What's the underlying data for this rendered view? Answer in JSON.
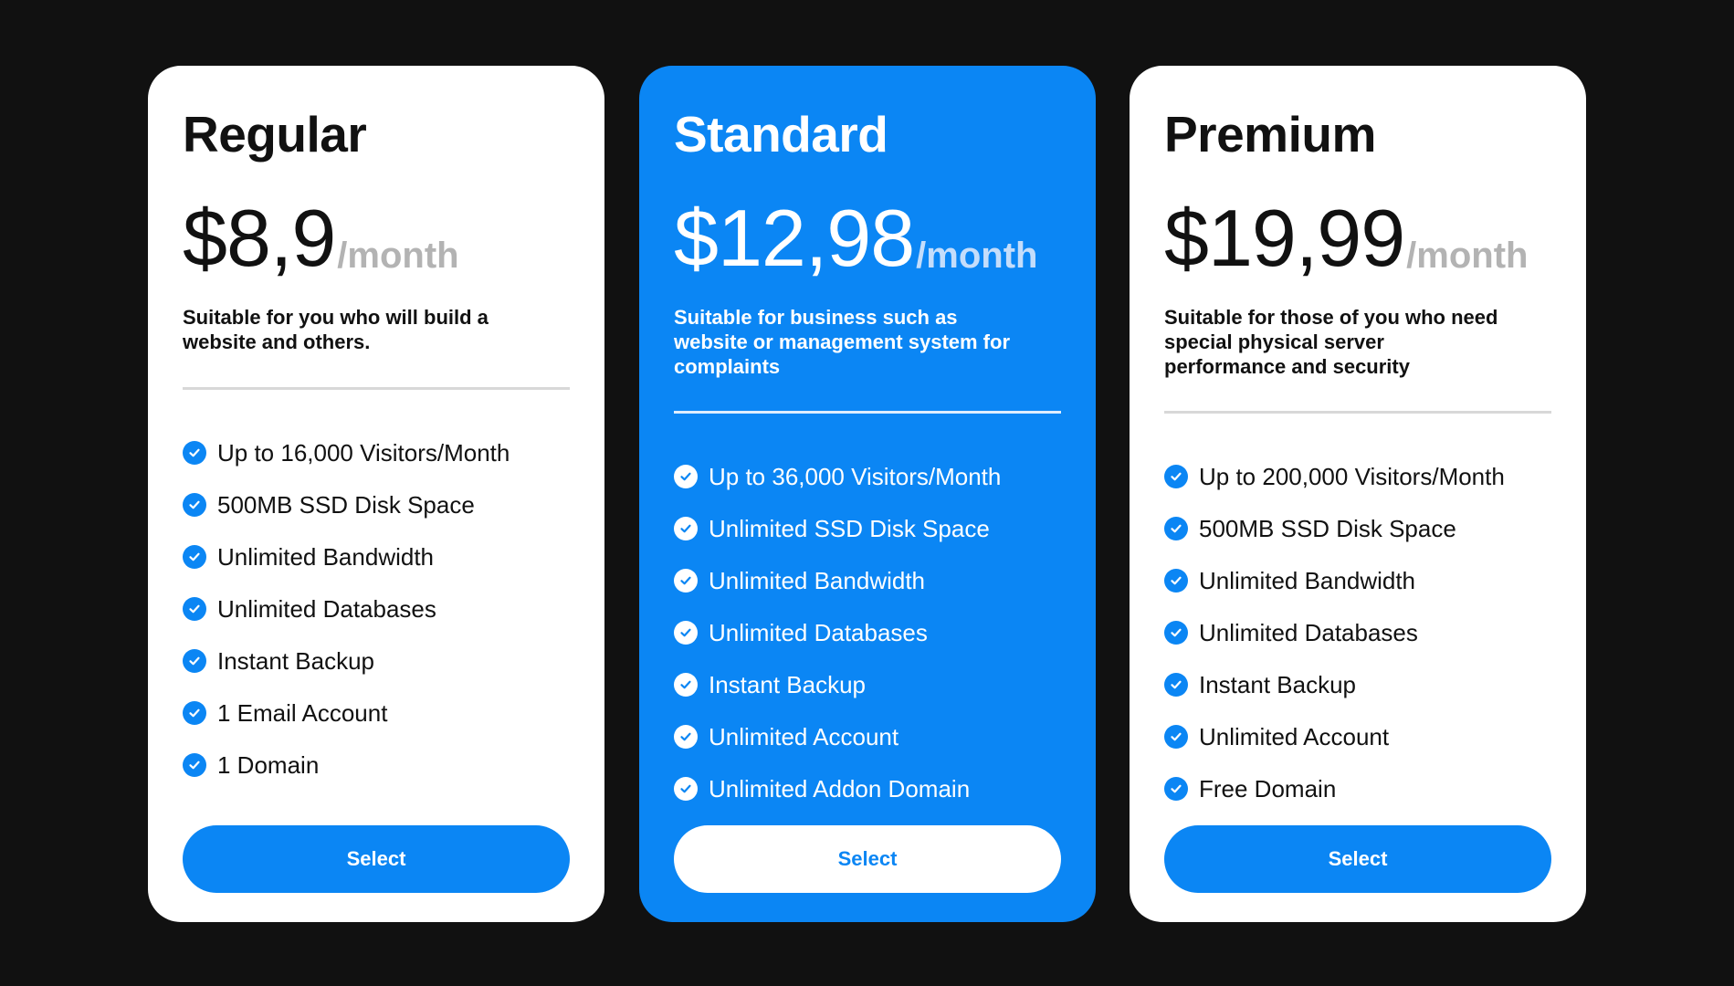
{
  "colors": {
    "background": "#111111",
    "accent": "#0b86f4",
    "card": "#ffffff",
    "muted": "#b3b3b3"
  },
  "plans": [
    {
      "name": "Regular",
      "price": "$8,9",
      "period": "/month",
      "description": "Suitable for you who will build a website and others.",
      "features": [
        "Up to 16,000 Visitors/Month",
        "500MB SSD Disk Space",
        "Unlimited Bandwidth",
        "Unlimited Databases",
        "Instant Backup",
        "1 Email Account",
        "1 Domain"
      ],
      "button_label": "Select",
      "check_icon": "check-circle-icon"
    },
    {
      "name": "Standard",
      "price": "$12,98",
      "period": "/month",
      "description": "Suitable for business such as website or management system for complaints",
      "features": [
        "Up to 36,000 Visitors/Month",
        "Unlimited SSD Disk Space",
        "Unlimited Bandwidth",
        "Unlimited Databases",
        "Instant Backup",
        "Unlimited Account",
        "Unlimited Addon Domain"
      ],
      "button_label": "Select",
      "check_icon": "check-circle-icon"
    },
    {
      "name": "Premium",
      "price": "$19,99",
      "period": "/month",
      "description": "Suitable for those of you who need special physical server performance and security",
      "features": [
        "Up to 200,000 Visitors/Month",
        "500MB SSD Disk Space",
        "Unlimited Bandwidth",
        "Unlimited Databases",
        "Instant Backup",
        "Unlimited Account",
        "Free Domain"
      ],
      "button_label": "Select",
      "check_icon": "check-circle-icon"
    }
  ]
}
